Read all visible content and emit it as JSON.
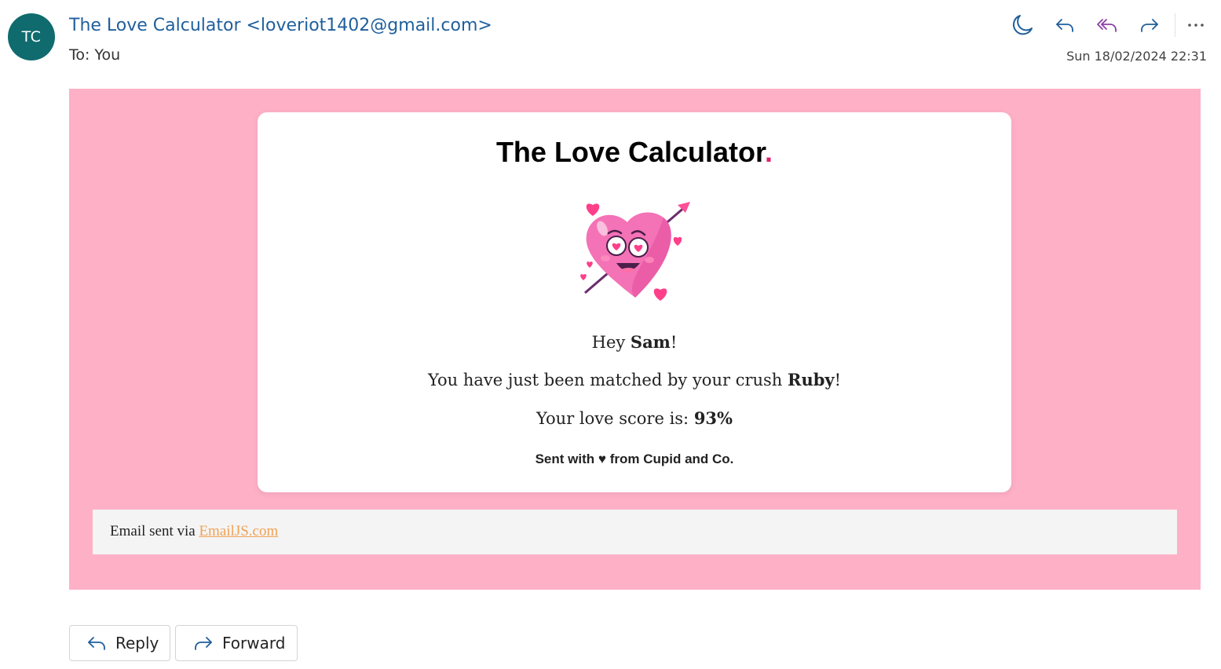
{
  "header": {
    "avatar_initials": "TC",
    "sender": "The Love Calculator <loveriot1402@gmail.com>",
    "to_label": "To:",
    "to_name": "You",
    "timestamp": "Sun 18/02/2024 22:31",
    "icons": [
      "moon-icon",
      "reply-icon",
      "reply-all-icon",
      "forward-icon",
      "more-icon"
    ]
  },
  "email": {
    "title": "The Love Calculator",
    "title_dot": ".",
    "greeting_prefix": "Hey ",
    "recipient_name": "Sam",
    "greeting_suffix": "!",
    "match_prefix": "You have just been matched by your crush ",
    "crush_name": "Ruby",
    "match_suffix": "!",
    "score_prefix": "Your love score is: ",
    "score_value": "93%",
    "signature": "Sent with ♥ from Cupid and Co."
  },
  "footer": {
    "sent_via_text": "Email sent via ",
    "link_text": "EmailJS.com"
  },
  "bottom_actions": {
    "reply_label": "Reply",
    "forward_label": "Forward"
  },
  "colors": {
    "accent_blue": "#1f5f9c",
    "avatar_bg": "#0f6b6e",
    "pink_background": "#fdb0c6",
    "title_dot": "#e0206c",
    "link": "#f0a256",
    "heart_pink": "#f472b6"
  }
}
